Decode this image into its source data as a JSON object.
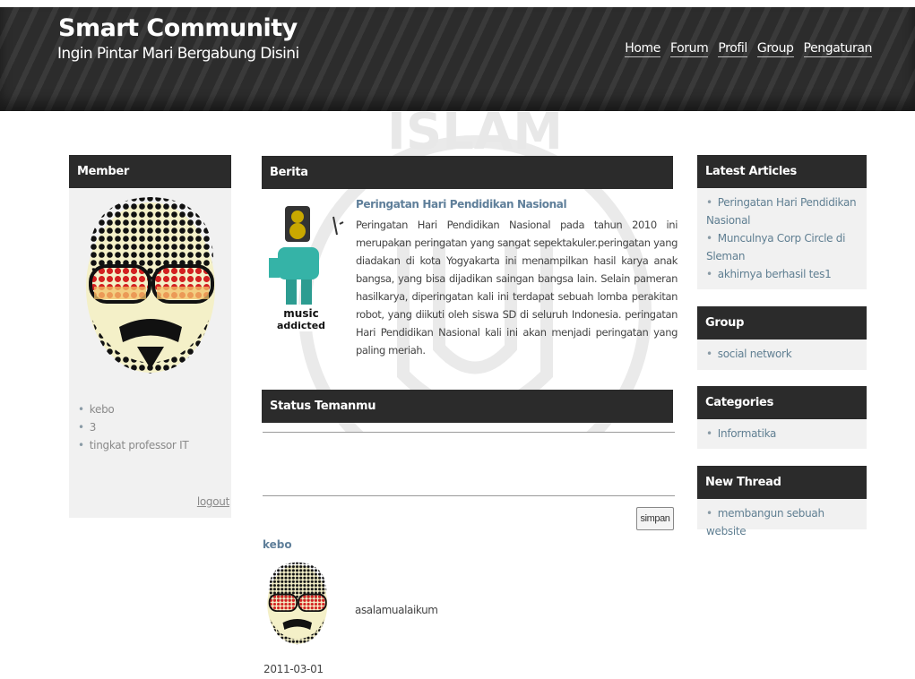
{
  "header": {
    "title": "Smart Community",
    "tagline": "Ingin Pintar Mari Bergabung Disini",
    "nav": [
      "Home",
      "Forum",
      "Profil",
      "Group",
      "Pengaturan"
    ]
  },
  "member": {
    "heading": "Member",
    "items": [
      "kebo",
      "3",
      "tingkat professor IT"
    ],
    "logout": "logout"
  },
  "berita": {
    "heading": "Berita",
    "image_text": "music addicted",
    "title": "Peringatan Hari Pendidikan Nasional",
    "body": "Peringatan Hari Pendidikan Nasional pada tahun 2010 ini merupakan peringatan yang sangat sepektakuler.peringatan yang diadakan di kota Yogyakarta ini menampilkan hasil karya anak bangsa, yang bisa dijadikan saingan bangsa lain. Selain pameran hasilkarya, diperingatan kali ini terdapat sebuah lomba perakitan robot, yang diikuti oleh siswa SD di seluruh Indonesia. peringatan Hari Pendidikan Nasional kali ini akan menjadi peringatan yang paling meriah."
  },
  "status": {
    "heading": "Status Temanmu",
    "input_value": "",
    "save_label": "simpan",
    "post": {
      "user": "kebo",
      "text": "asalamualaikum",
      "date": "2011-03-01"
    }
  },
  "sidebar": {
    "latest": {
      "heading": "Latest Articles",
      "items": [
        "Peringatan Hari Pendidikan Nasional",
        "Munculnya Corp Circle di Sleman",
        "akhirnya berhasil tes1"
      ]
    },
    "group": {
      "heading": "Group",
      "items": [
        "social network"
      ]
    },
    "categories": {
      "heading": "Categories",
      "items": [
        "Informatika"
      ]
    },
    "thread": {
      "heading": "New Thread",
      "items": [
        "membangun sebuah website"
      ]
    }
  },
  "watermark": {
    "text": "ISLAM"
  },
  "colors": {
    "panel_head": "#2b2b2b",
    "link": "#5f7f9a",
    "panel_bg": "#f1f1f1"
  }
}
